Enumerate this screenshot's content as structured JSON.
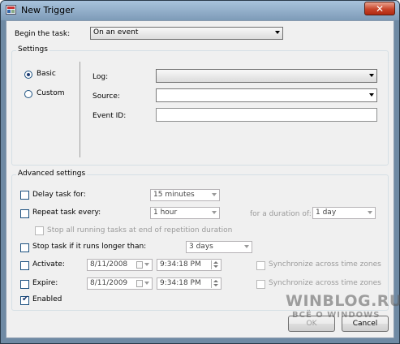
{
  "window": {
    "title": "New Trigger",
    "close_symbol": "✕"
  },
  "begin": {
    "label": "Begin the task:",
    "value": "On an event"
  },
  "settings": {
    "title": "Settings",
    "radio_basic": "Basic",
    "radio_custom": "Custom",
    "log_label": "Log:",
    "source_label": "Source:",
    "eventid_label": "Event ID:"
  },
  "advanced": {
    "title": "Advanced settings",
    "delay_label": "Delay task for:",
    "delay_value": "15 minutes",
    "repeat_label": "Repeat task every:",
    "repeat_value": "1 hour",
    "duration_label": "for a duration of:",
    "duration_value": "1 day",
    "stop_running_label": "Stop all running tasks at end of repetition duration",
    "stop_longer_label": "Stop task if it runs longer than:",
    "stop_longer_value": "3 days",
    "activate_label": "Activate:",
    "activate_date": "8/11/2008",
    "activate_time": "9:34:18 PM",
    "expire_label": "Expire:",
    "expire_date": "8/11/2009",
    "expire_time": "9:34:18 PM",
    "sync1_label": "Synchronize across time zones",
    "sync2_label": "Synchronize across time zones",
    "enabled_label": "Enabled",
    "enabled_checked": true
  },
  "buttons": {
    "ok": "OK",
    "cancel": "Cancel"
  },
  "watermark": {
    "line1": "WINBLOG.RU",
    "line2": "ВСЁ О WINDOWS"
  }
}
